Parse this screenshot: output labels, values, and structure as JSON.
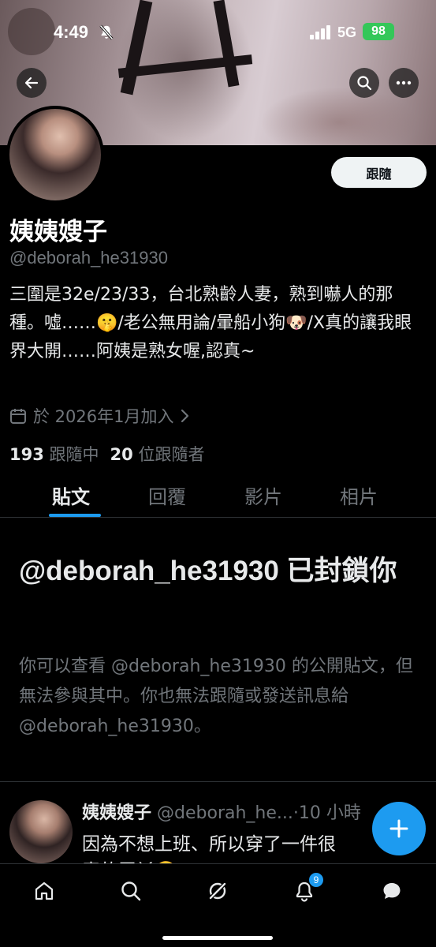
{
  "status_bar": {
    "time": "4:49",
    "network": "5G",
    "battery": "98"
  },
  "profile": {
    "follow_label": "跟隨",
    "display_name": "姨姨嫂子",
    "handle": "@deborah_he31930",
    "bio": "三圍是32e/23/33，台北熟齡人妻，熟到嚇人的那種。噓……🤫/老公無用論/暈船小狗🐶/X真的讓我眼界大開……阿姨是熟女喔,認真~",
    "joined": "於 2026年1月加入",
    "following_count": "193",
    "following_label": "跟隨中",
    "followers_count": "20",
    "followers_label": "位跟隨者"
  },
  "tabs": [
    "貼文",
    "回覆",
    "影片",
    "相片"
  ],
  "blocked": {
    "title": "@deborah_he31930 已封鎖你",
    "description": "你可以查看 @deborah_he31930 的公開貼文，但無法參與其中。你也無法跟隨或發送訊息給 @deborah_he31930。"
  },
  "tweet": {
    "author_name": "姨姨嫂子",
    "author_handle": "@deborah_he...",
    "time": "·10 小時",
    "line1": "因為不想上班、所以穿了一件很",
    "line2": "素的罩衫🤫"
  },
  "notification_badge": "9",
  "colors": {
    "accent": "#1d9bf0",
    "battery": "#34c759"
  }
}
